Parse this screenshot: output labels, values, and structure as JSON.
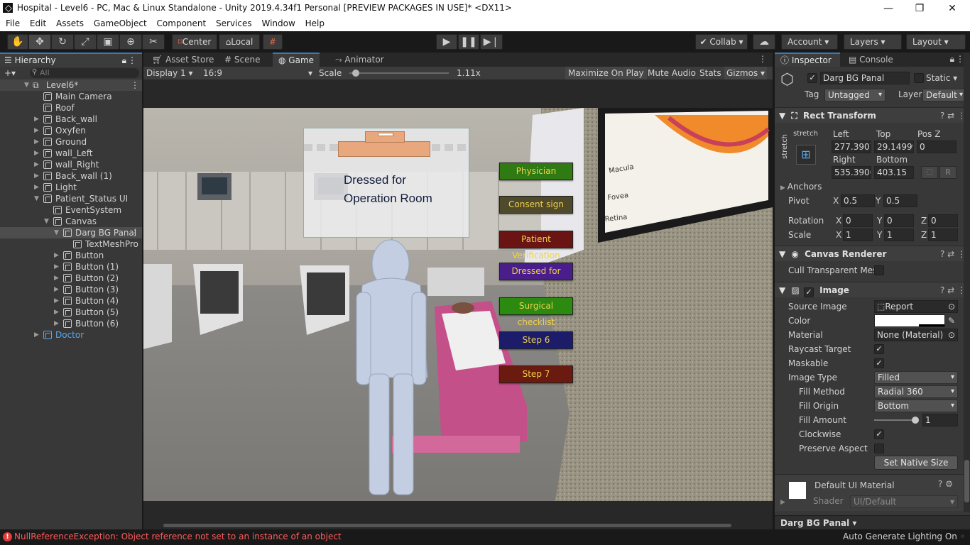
{
  "window": {
    "title": "Hospital - Level6 - PC, Mac & Linux Standalone - Unity 2019.4.34f1 Personal [PREVIEW PACKAGES IN USE]* <DX11>",
    "controls": [
      "—",
      "❐",
      "✕"
    ]
  },
  "menu": [
    "File",
    "Edit",
    "Assets",
    "GameObject",
    "Component",
    "Services",
    "Window",
    "Help"
  ],
  "toolbar": {
    "pivot": "Center",
    "space": "Local",
    "collab": "Collab",
    "account": "Account",
    "layers": "Layers",
    "layout": "Layout"
  },
  "hierarchy": {
    "tab": "Hierarchy",
    "search_placeholder": "All",
    "scene": "Level6*",
    "items": [
      {
        "label": "Main Camera",
        "indent": 1,
        "expand": ""
      },
      {
        "label": "Roof",
        "indent": 1,
        "expand": ""
      },
      {
        "label": "Back_wall",
        "indent": 1,
        "expand": "▶"
      },
      {
        "label": "Oxyfen",
        "indent": 1,
        "expand": "▶"
      },
      {
        "label": "Ground",
        "indent": 1,
        "expand": "▶"
      },
      {
        "label": "wall_Left",
        "indent": 1,
        "expand": "▶"
      },
      {
        "label": "wall_Right",
        "indent": 1,
        "expand": "▶"
      },
      {
        "label": "Back_wall (1)",
        "indent": 1,
        "expand": "▶"
      },
      {
        "label": "Light",
        "indent": 1,
        "expand": "▶"
      },
      {
        "label": "Patient_Status UI",
        "indent": 1,
        "expand": "▼"
      },
      {
        "label": "EventSystem",
        "indent": 2,
        "expand": ""
      },
      {
        "label": "Canvas",
        "indent": 2,
        "expand": "▼"
      },
      {
        "label": "Darg BG Panal",
        "indent": 3,
        "expand": "▼",
        "selected": true
      },
      {
        "label": "TextMeshPro",
        "indent": 4,
        "expand": ""
      },
      {
        "label": "Button",
        "indent": 3,
        "expand": "▶"
      },
      {
        "label": "Button (1)",
        "indent": 3,
        "expand": "▶"
      },
      {
        "label": "Button (2)",
        "indent": 3,
        "expand": "▶"
      },
      {
        "label": "Button (3)",
        "indent": 3,
        "expand": "▶"
      },
      {
        "label": "Button (4)",
        "indent": 3,
        "expand": "▶"
      },
      {
        "label": "Button (5)",
        "indent": 3,
        "expand": "▶"
      },
      {
        "label": "Button (6)",
        "indent": 3,
        "expand": "▶"
      },
      {
        "label": "Doctor",
        "indent": 1,
        "expand": "▶",
        "prefab": true
      }
    ]
  },
  "center_tabs": [
    "Asset Store",
    "Scene",
    "Game",
    "Animator"
  ],
  "game_toolbar": {
    "display": "Display 1",
    "aspect": "16:9",
    "scale_label": "Scale",
    "scale_value": "1.11x",
    "maximize": "Maximize On Play",
    "mute": "Mute Audio",
    "stats": "Stats",
    "gizmos": "Gizmos"
  },
  "game": {
    "panel_text_line1": "Dressed for",
    "panel_text_line2": "Operation Room",
    "buttons": [
      {
        "label": "Physician",
        "bg": "#2f7a12",
        "fg": "#f0d24a"
      },
      {
        "label": "Consent sign",
        "bg": "#4f4a2c",
        "fg": "#f0d24a"
      },
      {
        "label": "Patient Verification",
        "bg": "#6a1414",
        "fg": "#f0d24a"
      },
      {
        "label": "Dressed for",
        "bg": "#4a1e8a",
        "fg": "#f0d24a"
      },
      {
        "label": "Surgical checklist",
        "bg": "#2d8a10",
        "fg": "#f0d24a"
      },
      {
        "label": "Step 6",
        "bg": "#1c1c6a",
        "fg": "#f0d24a"
      },
      {
        "label": "Step 7",
        "bg": "#6a1a0e",
        "fg": "#f0d24a"
      }
    ],
    "poster_labels": [
      "Macula",
      "Fovea",
      "Retina"
    ]
  },
  "inspector": {
    "tabs": [
      "Inspector",
      "Console"
    ],
    "object_name": "Darg BG Panal",
    "static_label": "Static",
    "tag_label": "Tag",
    "tag_value": "Untagged",
    "layer_label": "Layer",
    "layer_value": "Default",
    "rect_transform": {
      "title": "Rect Transform",
      "stretch_h": "stretch",
      "stretch_v": "stretch",
      "left_label": "Left",
      "left": "277.3907",
      "top_label": "Top",
      "top": "29.14999",
      "posz_label": "Pos Z",
      "posz": "0",
      "right_label": "Right",
      "right": "535.3906",
      "bottom_label": "Bottom",
      "bottom": "403.15",
      "anchors": "Anchors",
      "pivot_label": "Pivot",
      "pivot_x": "0.5",
      "pivot_y": "0.5",
      "rotation_label": "Rotation",
      "rot_x": "0",
      "rot_y": "0",
      "rot_z": "0",
      "scale_label": "Scale",
      "scale_x": "1",
      "scale_y": "1",
      "scale_z": "1",
      "r_button": "R"
    },
    "canvas_renderer": {
      "title": "Canvas Renderer",
      "cull_label": "Cull Transparent Mes"
    },
    "image": {
      "title": "Image",
      "source_label": "Source Image",
      "source": "Report",
      "color_label": "Color",
      "material_label": "Material",
      "material": "None (Material)",
      "raycast_label": "Raycast Target",
      "maskable_label": "Maskable",
      "type_label": "Image Type",
      "type": "Filled",
      "fill_method_label": "Fill Method",
      "fill_method": "Radial 360",
      "fill_origin_label": "Fill Origin",
      "fill_origin": "Bottom",
      "fill_amount_label": "Fill Amount",
      "fill_amount": "1",
      "clockwise_label": "Clockwise",
      "preserve_label": "Preserve Aspect",
      "native_size": "Set Native Size"
    },
    "material_section": {
      "name": "Default UI Material",
      "shader_label": "Shader",
      "shader": "UI/Default"
    },
    "footer_object": "Darg BG Panal"
  },
  "status": {
    "error": "NullReferenceException: Object reference not set to an instance of an object",
    "lighting": "Auto Generate Lighting On"
  },
  "colors": {
    "error": "#ff5b5b",
    "accent": "#3a79bb",
    "prefab": "#5aa8ef"
  }
}
